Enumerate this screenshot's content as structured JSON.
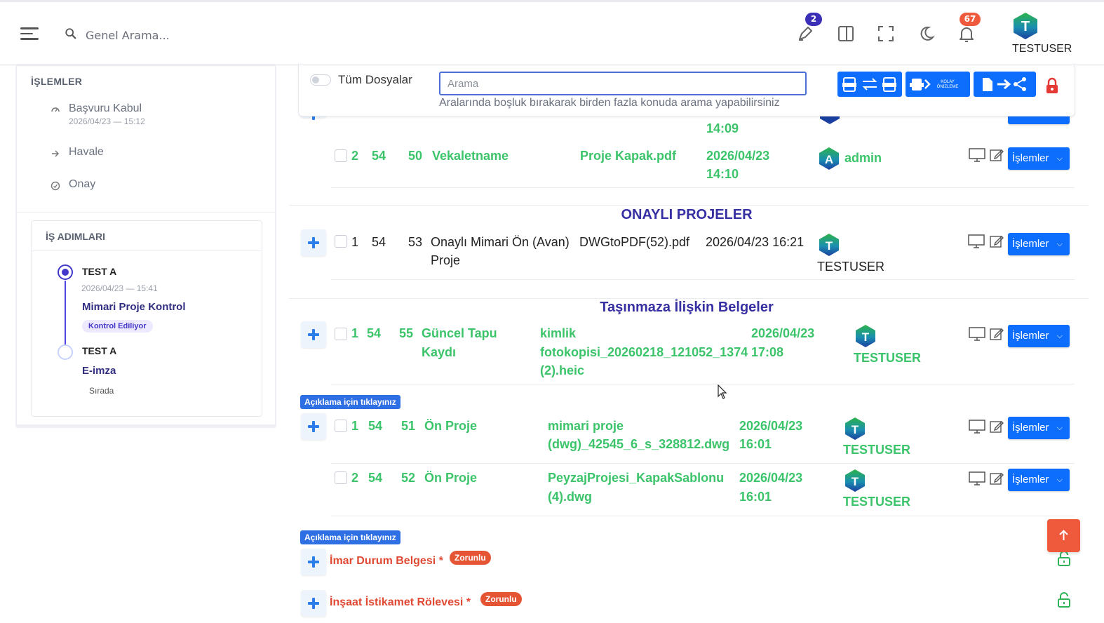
{
  "header": {
    "search_placeholder": "Genel Arama...",
    "pen_badge": "2",
    "notif_badge": "67",
    "user_name": "TESTUSER",
    "user_initial": "T"
  },
  "sidebar": {
    "islemler_title": "İŞLEMLER",
    "items": [
      {
        "label": "Başvuru Kabul",
        "sub": "2026/04/23 — 15:12"
      },
      {
        "label": "Havale"
      },
      {
        "label": "Onay"
      }
    ],
    "steps_title": "İŞ ADIMLARI",
    "steps": [
      {
        "user": "TEST A",
        "date": "2026/04/23 — 15:41",
        "name": "Mimari Proje Kontrol",
        "status": "Kontrol Ediliyor"
      },
      {
        "user": "TEST A",
        "name": "E-imza",
        "status": "Sırada"
      }
    ]
  },
  "toolbar": {
    "toggle_label": "Tüm Dosyalar",
    "search_placeholder": "Arama",
    "help_text": "Aralarında boşluk bırakarak birden fazla konuda arama yapabilirsiniz",
    "convert_label": "KOLAY ÖNİZLEME"
  },
  "rows": {
    "top_partial": {
      "time": "14:09"
    },
    "vekaletname": {
      "idx": "2",
      "c1": "54",
      "c2": "50",
      "type": "Vekaletname",
      "file": "Proje Kapak.pdf",
      "date": "2026/04/23",
      "time": "14:10",
      "user": "admin",
      "initial": "A"
    },
    "onayli_title": "ONAYLI PROJELER",
    "onayli": {
      "idx": "1",
      "c1": "54",
      "c2": "53",
      "type1": "Onaylı Mimari Ön (Avan)",
      "type2": "Proje",
      "file": "DWGtoPDF(52).pdf",
      "date": "2026/04/23 16:21",
      "user": "TESTUSER",
      "initial": "T"
    },
    "tasinmaz_title": "Taşınmaza İlişkin Belgeler",
    "tapu": {
      "idx": "1",
      "c1": "54",
      "c2": "55",
      "type1": "Güncel Tapu",
      "type2": "Kaydı",
      "file1": "kimlik",
      "file2": "fotokopisi_20260218_121052_1374",
      "file3": "(2).heic",
      "date": "2026/04/23",
      "time": "17:08",
      "user": "TESTUSER",
      "initial": "T"
    },
    "aciklama": "Açıklama için tıklayınız",
    "on_proje_1": {
      "idx": "1",
      "c1": "54",
      "c2": "51",
      "type": "Ön Proje",
      "file1": "mimari proje",
      "file2": "(dwg)_42545_6_s_328812.dwg",
      "date": "2026/04/23",
      "time": "16:01",
      "user": "TESTUSER",
      "initial": "T"
    },
    "on_proje_2": {
      "idx": "2",
      "c1": "54",
      "c2": "52",
      "type": "Ön Proje",
      "file1": "PeyzajProjesi_KapakSablonu",
      "file2": "(4).dwg",
      "date": "2026/04/23",
      "time": "16:01",
      "user": "TESTUSER",
      "initial": "T"
    },
    "imar": {
      "label": "İmar Durum Belgesi",
      "star": "*",
      "badge": "Zorunlu"
    },
    "insaat": {
      "label": "İnşaat İstikamet Rölevesi",
      "star": "*",
      "badge": "Zorunlu"
    }
  },
  "actions_label": "İşlemler",
  "colors": {
    "primary": "#0d6efd",
    "green": "#3cc46b",
    "danger": "#e55533",
    "indigo": "#3730a3"
  }
}
